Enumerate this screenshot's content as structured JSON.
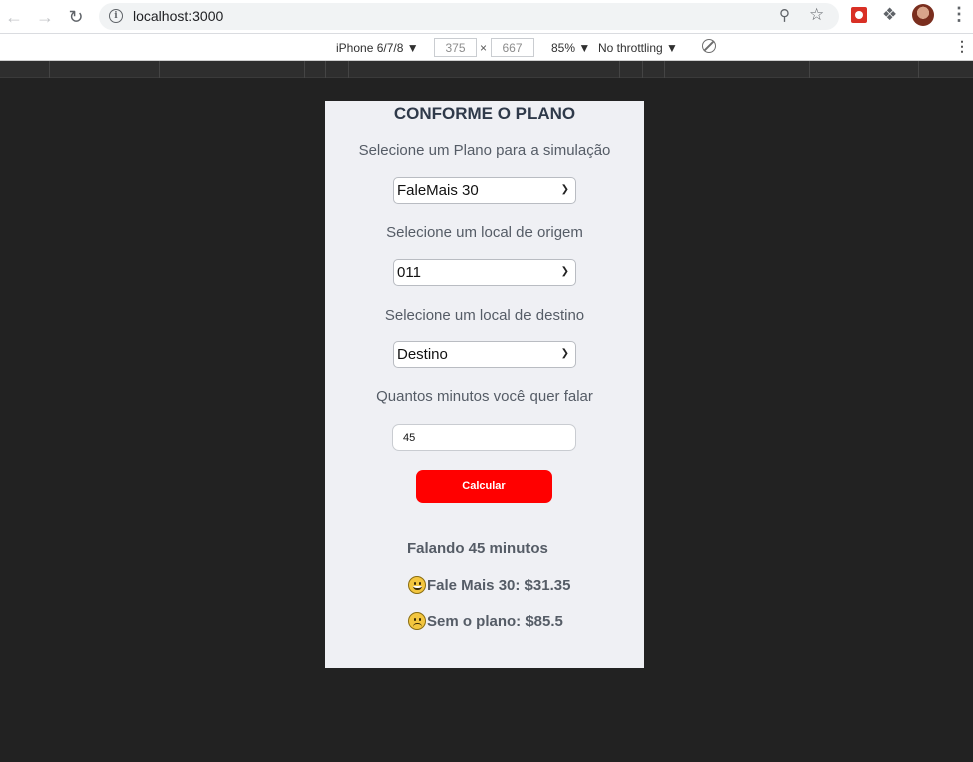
{
  "browser": {
    "url": "localhost:3000"
  },
  "devtools": {
    "device": "iPhone 6/7/8 ▼",
    "width": "375",
    "height": "667",
    "times": "×",
    "zoom": "85% ▼",
    "throttling": "No throttling ▼"
  },
  "app": {
    "title": "CONFORME O PLANO",
    "plan_label": "Selecione um Plano para a simulação",
    "plan_value": "FaleMais 30",
    "origin_label": "Selecione um local de origem",
    "origin_value": "011",
    "destination_label": "Selecione um local de destino",
    "destination_value": "Destino",
    "minutes_label": "Quantos minutos você quer falar",
    "minutes_value": "45",
    "button_label": "Calcular",
    "result_heading": "Falando 45 minutos",
    "result_with_plan": "Fale Mais 30: $31.35",
    "result_without_plan": "Sem o plano: $85.5"
  },
  "colors": {
    "button": "#ff0000",
    "viewport_bg": "#eff0f4",
    "page_bg": "#222222"
  }
}
